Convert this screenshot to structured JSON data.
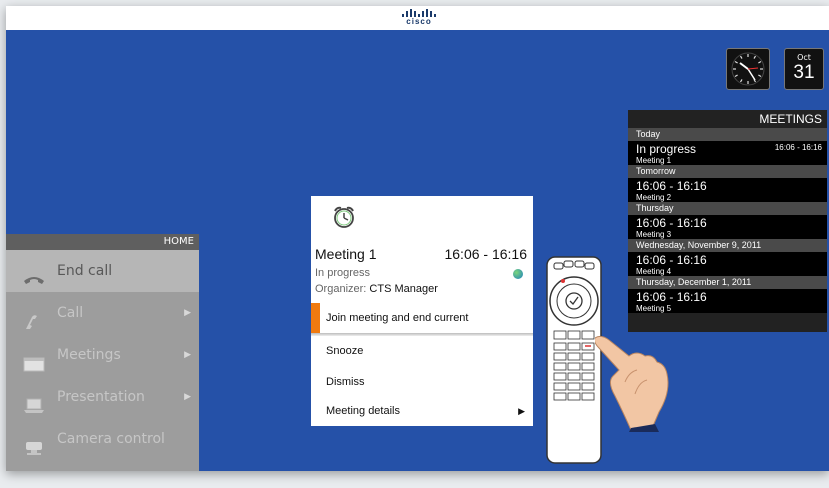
{
  "brand": {
    "logo_text": "cisco"
  },
  "calendar": {
    "month": "Oct",
    "day": "31"
  },
  "meetings_panel": {
    "title": "MEETINGS",
    "groups": [
      {
        "day": "Today",
        "entries": [
          {
            "time": "In progress",
            "name": "Meeting 1",
            "range": "16:06 - 16:16"
          }
        ]
      },
      {
        "day": "Tomorrow",
        "entries": [
          {
            "time": "16:06 - 16:16",
            "name": "Meeting 2"
          }
        ]
      },
      {
        "day": "Thursday",
        "entries": [
          {
            "time": "16:06 - 16:16",
            "name": "Meeting 3"
          }
        ]
      },
      {
        "day": "Wednesday, November 9, 2011",
        "entries": [
          {
            "time": "16:06 - 16:16",
            "name": "Meeting 4"
          }
        ]
      },
      {
        "day": "Thursday, December 1, 2011",
        "entries": [
          {
            "time": "16:06 - 16:16",
            "name": "Meeting 5"
          }
        ]
      }
    ]
  },
  "home_menu": {
    "header": "HOME",
    "items": [
      {
        "label": "End call",
        "icon": "handset-icon",
        "arrow": ""
      },
      {
        "label": "Call",
        "icon": "phone-icon",
        "arrow": "▶"
      },
      {
        "label": "Meetings",
        "icon": "calendar-icon",
        "arrow": "▶"
      },
      {
        "label": "Presentation",
        "icon": "laptop-icon",
        "arrow": "▶"
      },
      {
        "label": "Camera control",
        "icon": "camera-icon",
        "arrow": ""
      }
    ]
  },
  "reminder": {
    "title": "Meeting 1",
    "time": "16:06 - 16:16",
    "status": "In progress",
    "organizer_label": "Organizer:",
    "organizer_name": "CTS Manager",
    "options": [
      {
        "label": "Join meeting and end current",
        "arrow": ""
      },
      {
        "label": "Snooze",
        "arrow": ""
      },
      {
        "label": "Dismiss",
        "arrow": ""
      },
      {
        "label": "Meeting details",
        "arrow": "▶"
      }
    ]
  },
  "colors": {
    "screen_bg": "#2551a8",
    "accent": "#f07a10"
  }
}
